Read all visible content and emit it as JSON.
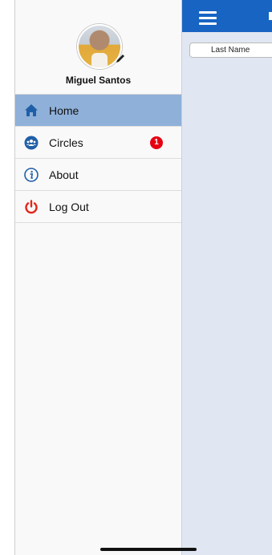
{
  "profile": {
    "name": "Miguel Santos"
  },
  "menu": {
    "items": [
      {
        "label": "Home",
        "icon": "home-icon",
        "active": true
      },
      {
        "label": "Circles",
        "icon": "people-group-icon",
        "badge": "1"
      },
      {
        "label": "About",
        "icon": "info-icon"
      },
      {
        "label": "Log Out",
        "icon": "power-icon"
      }
    ]
  },
  "main": {
    "sort_button_label": "Last Name"
  },
  "colors": {
    "header": "#1764c3",
    "active_item": "#8fb0d9",
    "badge": "#e60012",
    "logout_icon": "#e3261c",
    "icon_blue": "#1f5fa8"
  }
}
